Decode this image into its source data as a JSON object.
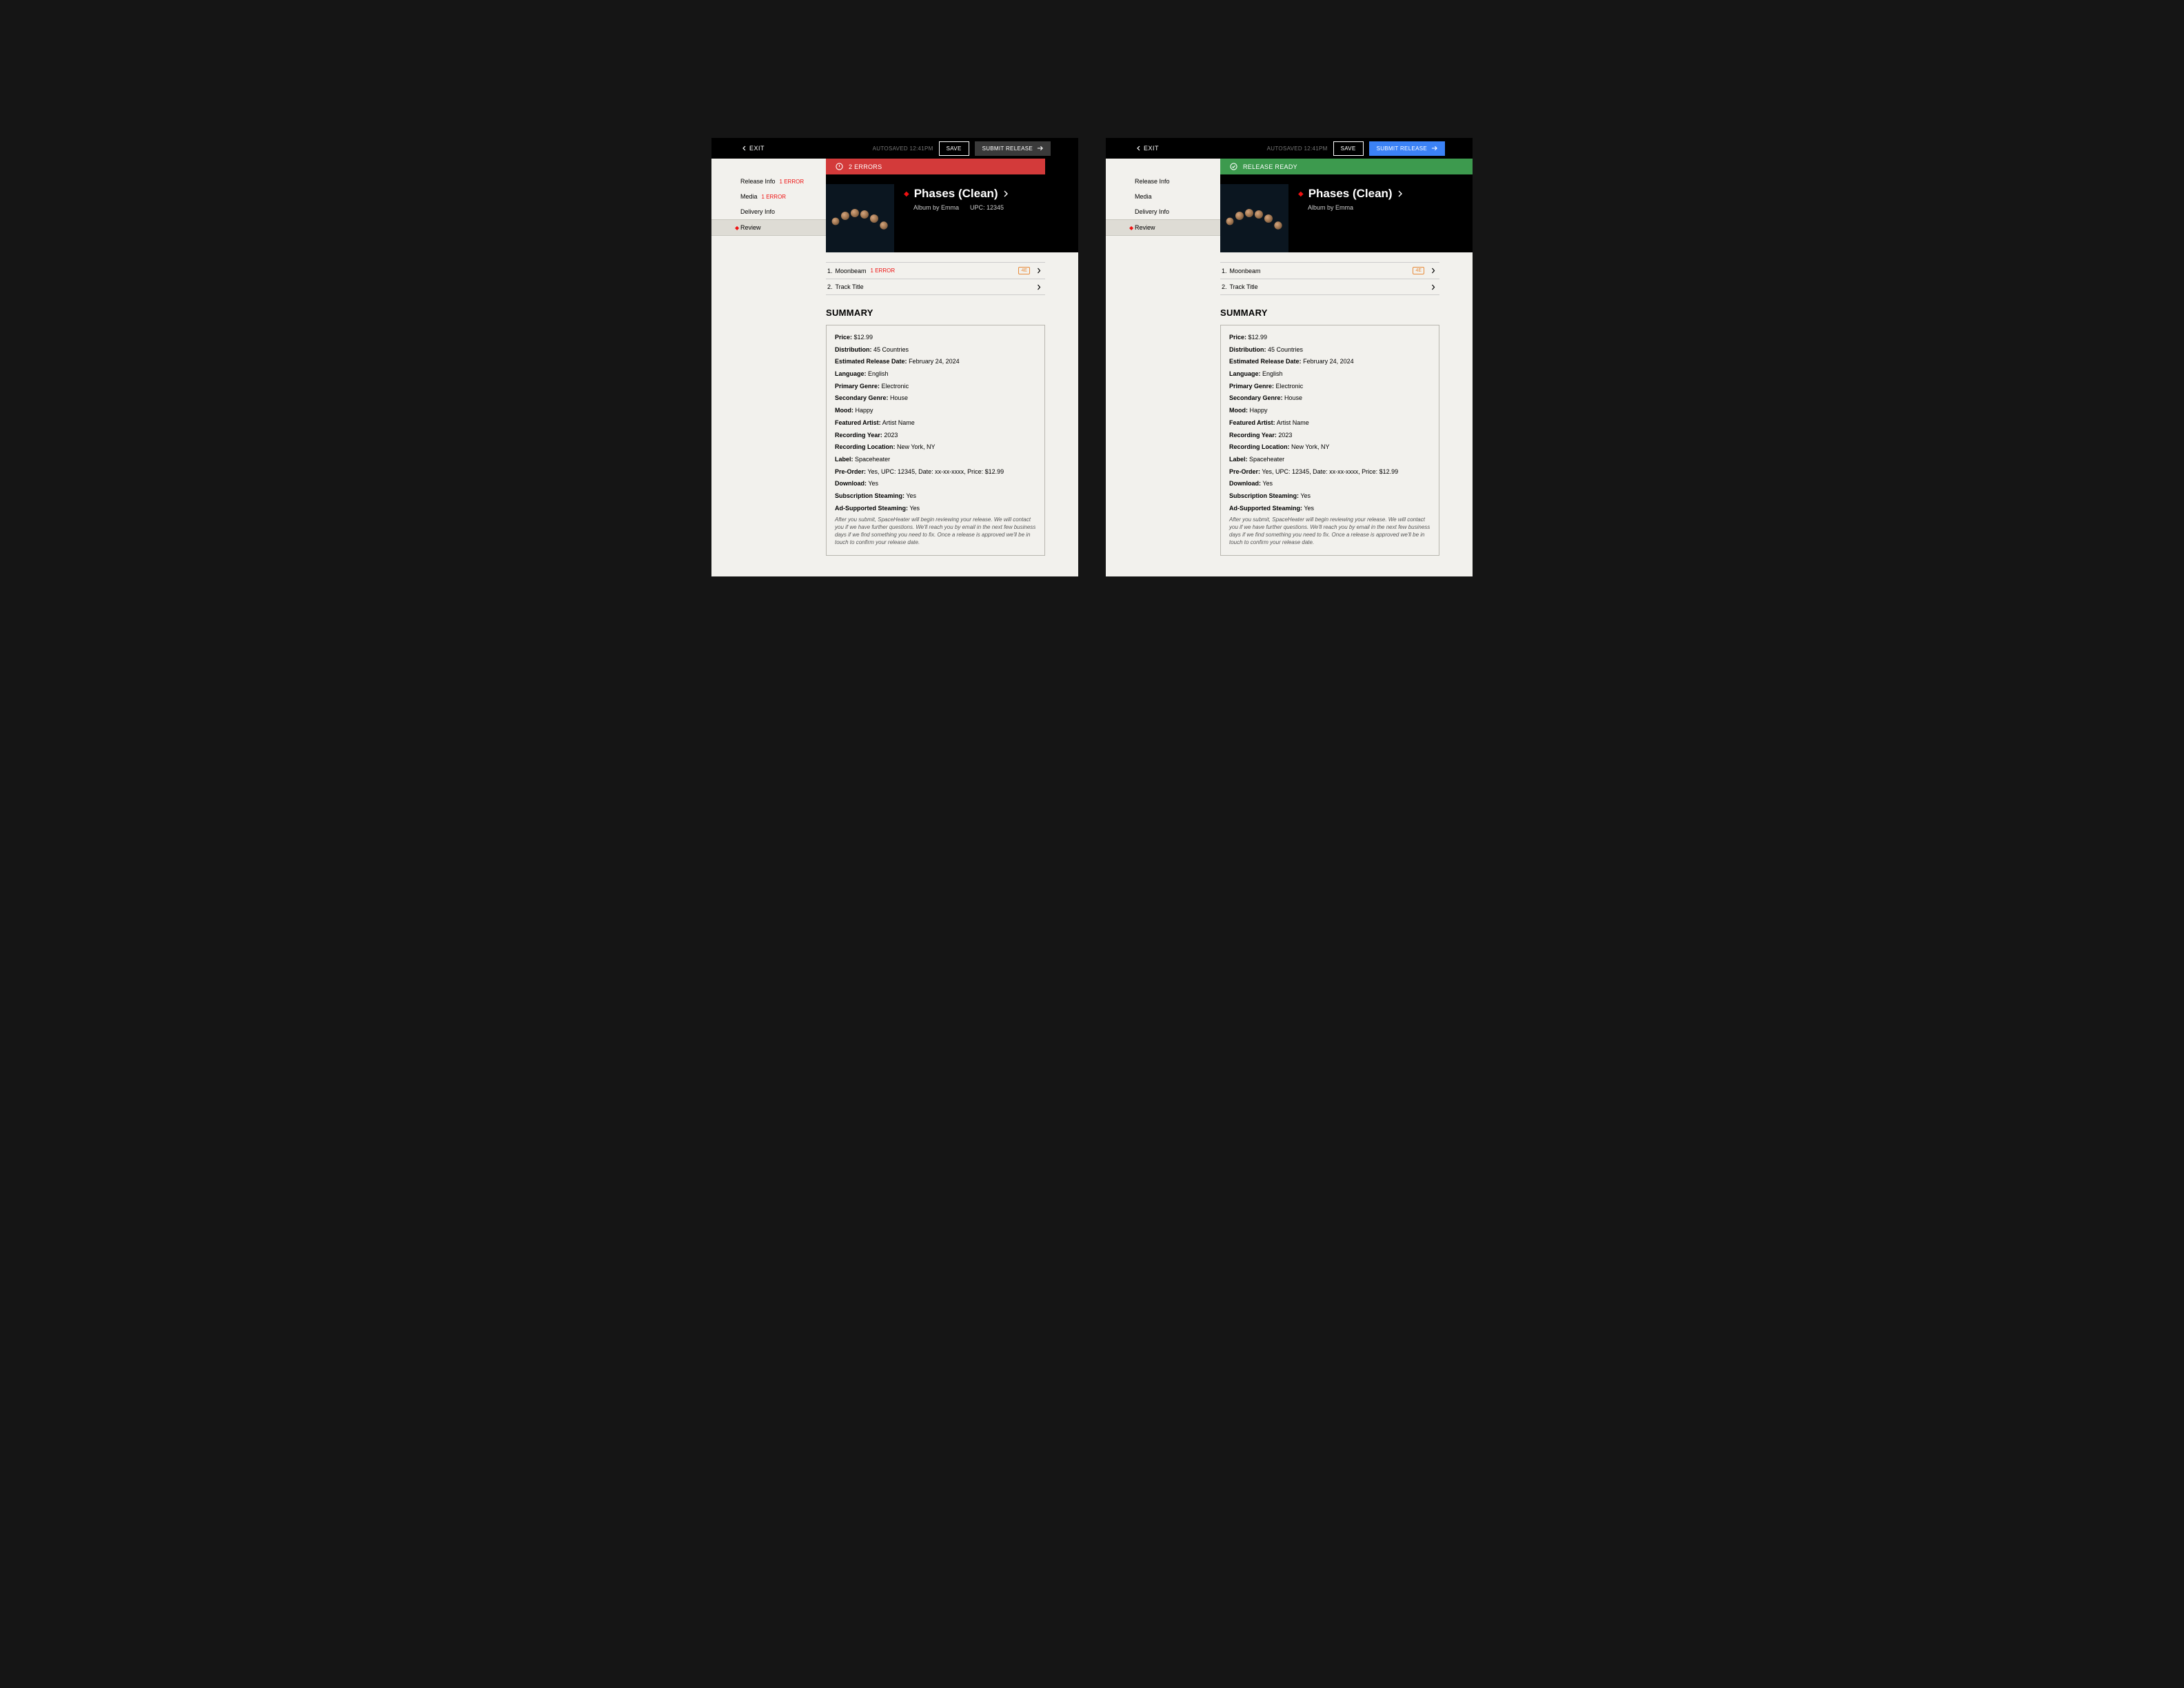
{
  "shared": {
    "exit_label": "EXIT",
    "autosaved": "AUTOSAVED 12:41PM",
    "save_label": "SAVE",
    "submit_label": "SUBMIT RELEASE",
    "title": "Phases (Clean)",
    "byline": "Album by Emma",
    "upc": "UPC: 12345",
    "summary_heading": "SUMMARY",
    "sidebar": [
      {
        "label": "Release Info"
      },
      {
        "label": "Media"
      },
      {
        "label": "Delivery Info"
      },
      {
        "label": "Review"
      }
    ],
    "tracks": [
      {
        "num": "1.",
        "title": "Moonbeam",
        "badge": "4E"
      },
      {
        "num": "2.",
        "title": "Track Title"
      }
    ],
    "summary": {
      "price_l": "Price:",
      "price_v": "$12.99",
      "dist_l": "Distribution:",
      "dist_v": "45 Countries",
      "erd_l": "Estimated Release Date:",
      "erd_v": "February 24, 2024",
      "lang_l": "Language:",
      "lang_v": "English",
      "pg_l": "Primary Genre:",
      "pg_v": "Electronic",
      "sg_l": "Secondary Genre:",
      "sg_v": "House",
      "mood_l": "Mood:",
      "mood_v": "Happy",
      "fa_l": "Featured Artist:",
      "fa_v": "Artist Name",
      "ry_l": "Recording Year:",
      "ry_v": "2023",
      "rl_l": "Recording Location:",
      "rl_v": "New York, NY",
      "label_l": "Label:",
      "label_v": "Spaceheater",
      "po_l": "Pre-Order:",
      "po_v": "Yes, UPC: 12345, Date: xx-xx-xxxx, Price: $12.99",
      "dl_l": "Download:",
      "dl_v": "Yes",
      "ss_l": "Subscription Steaming:",
      "ss_v": "Yes",
      "as_l": "Ad-Supported Steaming:",
      "as_v": "Yes"
    },
    "note": "After you submit, SpaceHeater will begin reviewing your release. We will contact you if we have further questions. We'll reach you by email in the next few business days if we find something you need to fix. Once a release is approved we'll be in touch to confirm your release date."
  },
  "left": {
    "status_text": "2 ERRORS",
    "sidebar_errors": {
      "release_info": "1 ERROR",
      "media": "1 ERROR"
    },
    "track_error": "1 ERROR"
  },
  "right": {
    "status_text": "RELEASE READY"
  }
}
